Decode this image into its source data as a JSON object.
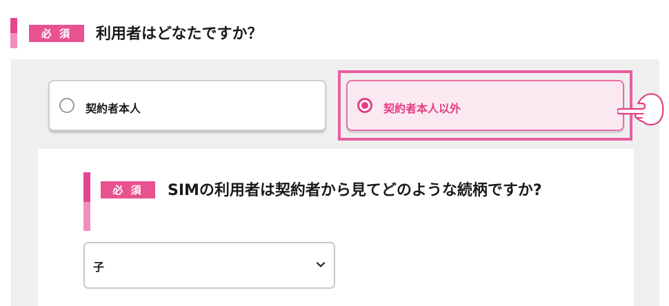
{
  "question1": {
    "badge": "必 須",
    "title": "利用者はどなたですか？",
    "options": [
      {
        "label": "契約者本人",
        "selected": false
      },
      {
        "label": "契約者本人以外",
        "selected": true
      }
    ]
  },
  "question2": {
    "badge": "必 須",
    "title": "SIMの利用者は契約者から見てどのような続柄ですか?",
    "select": {
      "value": "子"
    }
  },
  "colors": {
    "accent": "#e23d83",
    "badge": "#e8528f",
    "bar_dark": "#e4458f",
    "bar_light": "#f08fba",
    "panel_bg": "#efefef",
    "selected_bg": "#fbe9f1"
  },
  "icons": {
    "pointer": "hand-pointer-icon",
    "chevron": "chevron-down-icon"
  }
}
